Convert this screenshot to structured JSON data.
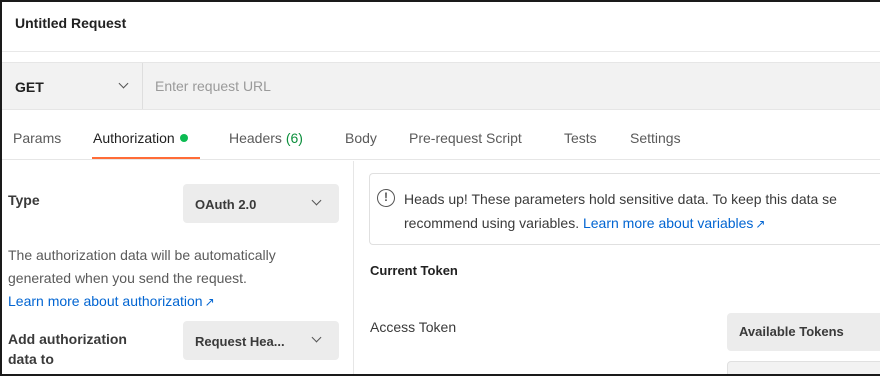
{
  "request": {
    "title": "Untitled Request"
  },
  "url_bar": {
    "method": "GET",
    "url_value": "",
    "url_placeholder": "Enter request URL"
  },
  "tabs": {
    "params": "Params",
    "authorization": "Authorization",
    "headers": "Headers",
    "headers_count": "(6)",
    "body": "Body",
    "pre_request_script": "Pre-request Script",
    "tests": "Tests",
    "settings": "Settings",
    "active": "Authorization"
  },
  "auth": {
    "type_label": "Type",
    "type_value": "OAuth 2.0",
    "description": "The authorization data will be automatically generated when you send the request.",
    "learn_more": "Learn more about authorization",
    "add_to_label": "Add authorization data to",
    "add_to_value": "Request Hea..."
  },
  "notice": {
    "text_line1": "Heads up! These parameters hold sensitive data. To keep this data se",
    "text_line2": "recommend using variables.",
    "link": "Learn more about variables"
  },
  "token": {
    "section_title": "Current Token",
    "access_token_label": "Access Token",
    "available_tokens": "Available Tokens"
  },
  "colors": {
    "accent_orange": "#ff6c37",
    "active_dot_green": "#0cbb52",
    "link_blue": "#0265d2"
  },
  "icons": {
    "method_dropdown": "chevron-down-icon",
    "info": "info-circle-icon",
    "external_link": "arrow-up-right-icon"
  }
}
